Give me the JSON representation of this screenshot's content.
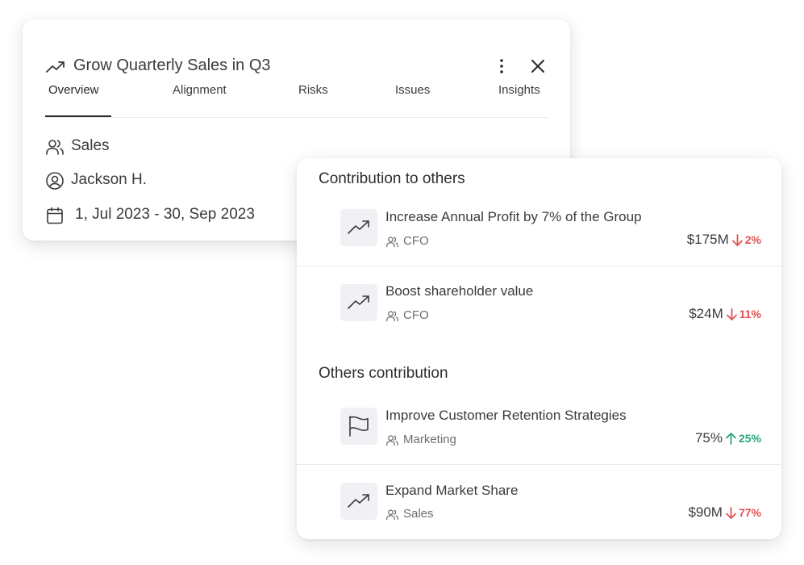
{
  "goal": {
    "title": "Grow Quarterly Sales in Q3",
    "tabs": [
      "Overview",
      "Alignment",
      "Risks",
      "Issues",
      "Insights"
    ],
    "active_tab": "Overview",
    "team": "Sales",
    "owner": "Jackson H.",
    "date_range": "1, Jul 2023 - 30, Sep 2023"
  },
  "contribution_to_others": {
    "title": "Contribution to others",
    "items": [
      {
        "title": "Increase Annual Profit by 7% of the Group",
        "owner": "CFO",
        "value": "$175M",
        "change": "2%",
        "direction": "down",
        "icon": "trend-up-icon"
      },
      {
        "title": "Boost shareholder value",
        "owner": "CFO",
        "value": "$24M",
        "change": "11%",
        "direction": "down",
        "icon": "trend-up-icon"
      }
    ]
  },
  "others_contribution": {
    "title": "Others contribution",
    "items": [
      {
        "title": "Improve Customer Retention Strategies",
        "owner": "Marketing",
        "value": "75%",
        "change": "25%",
        "direction": "up",
        "icon": "flag-icon"
      },
      {
        "title": "Expand Market Share",
        "owner": "Sales",
        "value": "$90M",
        "change": "77%",
        "direction": "down",
        "icon": "trend-up-icon"
      }
    ]
  },
  "colors": {
    "down": "#e05252",
    "up": "#27a777",
    "icon_bg": "#f1f1f5"
  }
}
